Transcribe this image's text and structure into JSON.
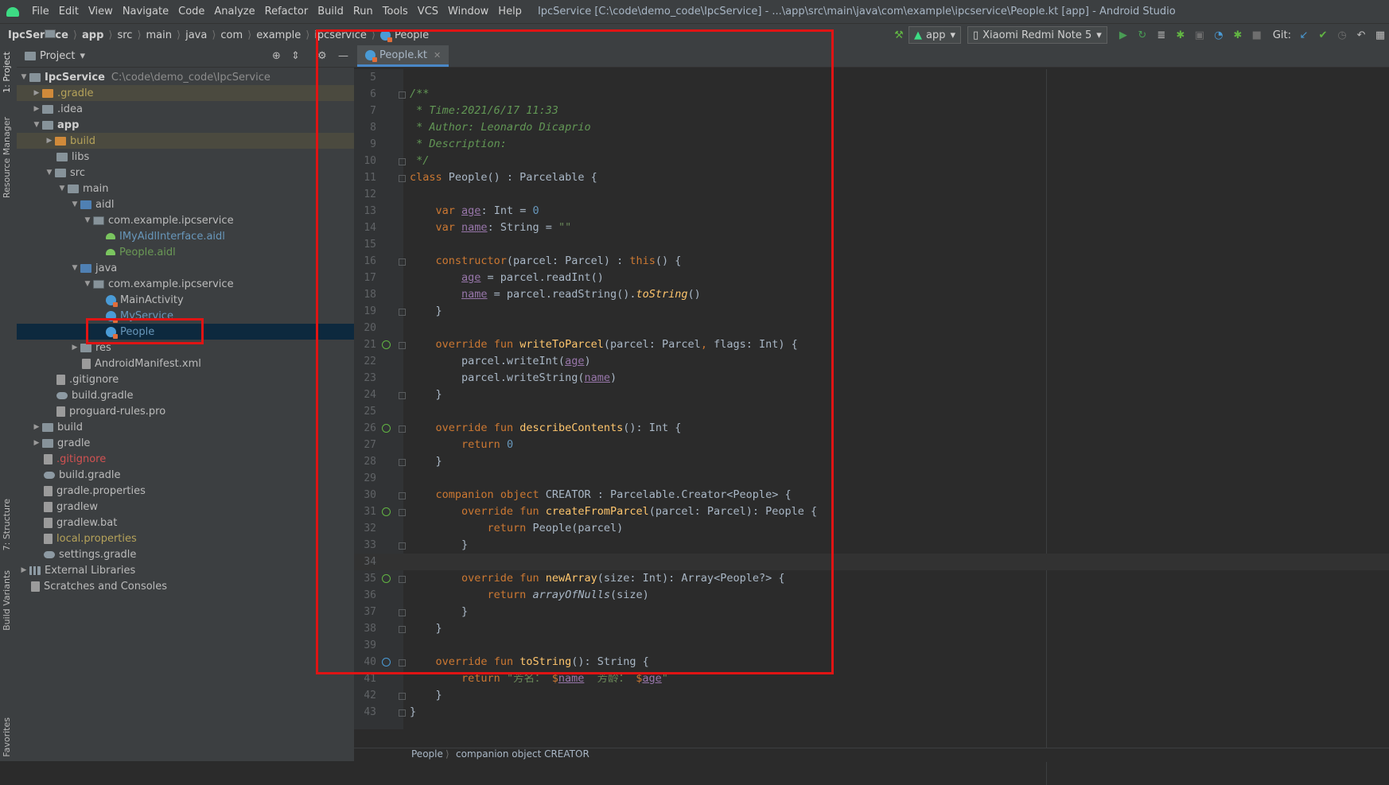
{
  "window_title": "IpcService [C:\\code\\demo_code\\IpcService] - ...\\app\\src\\main\\java\\com\\example\\ipcservice\\People.kt [app] - Android Studio",
  "menu": [
    "File",
    "Edit",
    "View",
    "Navigate",
    "Code",
    "Analyze",
    "Refactor",
    "Build",
    "Run",
    "Tools",
    "VCS",
    "Window",
    "Help"
  ],
  "breadcrumbs": [
    "IpcService",
    "app",
    "src",
    "main",
    "java",
    "com",
    "example",
    "ipcservice",
    "People"
  ],
  "toolbar": {
    "config": "app",
    "device": "Xiaomi Redmi Note 5",
    "git_label": "Git:"
  },
  "side_tabs": {
    "project": "1: Project",
    "resource_manager": "Resource Manager",
    "structure": "7: Structure",
    "build_variants": "Build Variants",
    "favorites": "Favorites"
  },
  "project_panel": {
    "title": "Project"
  },
  "tree": [
    {
      "label": "IpcService",
      "path": "C:\\code\\demo_code\\IpcService"
    },
    {
      "label": ".gradle"
    },
    {
      "label": ".idea"
    },
    {
      "label": "app"
    },
    {
      "label": "build"
    },
    {
      "label": "libs"
    },
    {
      "label": "src"
    },
    {
      "label": "main"
    },
    {
      "label": "aidl"
    },
    {
      "label": "com.example.ipcservice"
    },
    {
      "label": "IMyAidlInterface.aidl"
    },
    {
      "label": "People.aidl"
    },
    {
      "label": "java"
    },
    {
      "label": "com.example.ipcservice"
    },
    {
      "label": "MainActivity"
    },
    {
      "label": "MyService"
    },
    {
      "label": "People"
    },
    {
      "label": "res"
    },
    {
      "label": "AndroidManifest.xml"
    },
    {
      "label": ".gitignore"
    },
    {
      "label": "build.gradle"
    },
    {
      "label": "proguard-rules.pro"
    },
    {
      "label": "build"
    },
    {
      "label": "gradle"
    },
    {
      "label": ".gitignore"
    },
    {
      "label": "build.gradle"
    },
    {
      "label": "gradle.properties"
    },
    {
      "label": "gradlew"
    },
    {
      "label": "gradlew.bat"
    },
    {
      "label": "local.properties"
    },
    {
      "label": "settings.gradle"
    },
    {
      "label": "External Libraries"
    },
    {
      "label": "Scratches and Consoles"
    }
  ],
  "editor": {
    "tab": "People.kt",
    "status_crumbs": [
      "People",
      "companion object CREATOR"
    ]
  },
  "code_lines": [
    {
      "n": "5",
      "t": ""
    },
    {
      "n": "6",
      "t": "/**"
    },
    {
      "n": "7",
      "t": " * Time:2021/6/17 11:33"
    },
    {
      "n": "8",
      "t": " * Author: Leonardo Dicaprio"
    },
    {
      "n": "9",
      "t": " * Description:"
    },
    {
      "n": "10",
      "t": " */"
    },
    {
      "n": "11",
      "t": "class People() : Parcelable {"
    },
    {
      "n": "12",
      "t": ""
    },
    {
      "n": "13",
      "t": "    var age: Int = 0"
    },
    {
      "n": "14",
      "t": "    var name: String = \"\""
    },
    {
      "n": "15",
      "t": ""
    },
    {
      "n": "16",
      "t": "    constructor(parcel: Parcel) : this() {"
    },
    {
      "n": "17",
      "t": "        age = parcel.readInt()"
    },
    {
      "n": "18",
      "t": "        name = parcel.readString().toString()"
    },
    {
      "n": "19",
      "t": "    }"
    },
    {
      "n": "20",
      "t": ""
    },
    {
      "n": "21",
      "t": "    override fun writeToParcel(parcel: Parcel, flags: Int) {"
    },
    {
      "n": "22",
      "t": "        parcel.writeInt(age)"
    },
    {
      "n": "23",
      "t": "        parcel.writeString(name)"
    },
    {
      "n": "24",
      "t": "    }"
    },
    {
      "n": "25",
      "t": ""
    },
    {
      "n": "26",
      "t": "    override fun describeContents(): Int {"
    },
    {
      "n": "27",
      "t": "        return 0"
    },
    {
      "n": "28",
      "t": "    }"
    },
    {
      "n": "29",
      "t": ""
    },
    {
      "n": "30",
      "t": "    companion object CREATOR : Parcelable.Creator<People> {"
    },
    {
      "n": "31",
      "t": "        override fun createFromParcel(parcel: Parcel): People {"
    },
    {
      "n": "32",
      "t": "            return People(parcel)"
    },
    {
      "n": "33",
      "t": "        }"
    },
    {
      "n": "34",
      "t": ""
    },
    {
      "n": "35",
      "t": "        override fun newArray(size: Int): Array<People?> {"
    },
    {
      "n": "36",
      "t": "            return arrayOfNulls(size)"
    },
    {
      "n": "37",
      "t": "        }"
    },
    {
      "n": "38",
      "t": "    }"
    },
    {
      "n": "39",
      "t": ""
    },
    {
      "n": "40",
      "t": "    override fun toString(): String {"
    },
    {
      "n": "41",
      "t": "        return \"芳名： $name  芳龄： $age\""
    },
    {
      "n": "42",
      "t": "    }"
    },
    {
      "n": "43",
      "t": "}"
    }
  ]
}
